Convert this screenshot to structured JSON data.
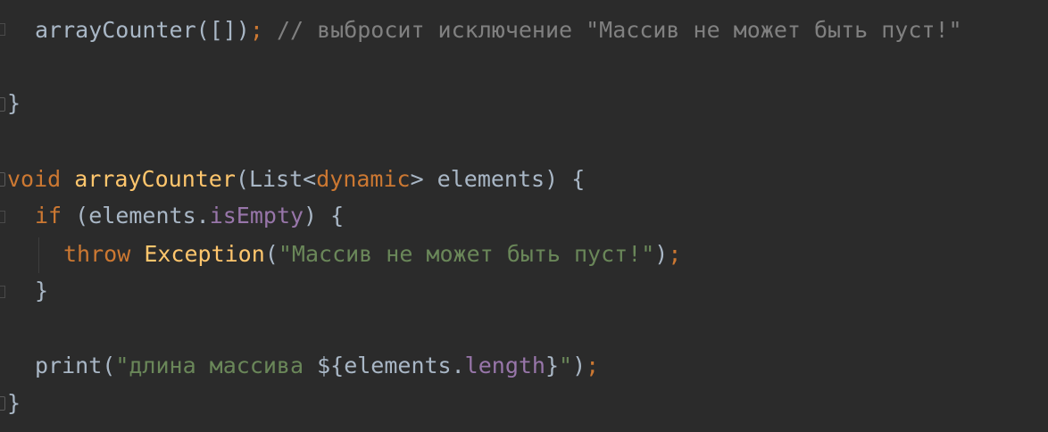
{
  "editor": {
    "lines": {
      "l1": {
        "call": "arrayCounter([])",
        "semi": ";",
        "comment": " // выбросит исключение \"Массив не может быть пуст!\""
      },
      "l2": {
        "brace": "}"
      },
      "l3": {
        "kw_void": "void",
        "fn_name": "arrayCounter",
        "open": "(List<",
        "type_dynamic": "dynamic",
        "rest": "> elements) {"
      },
      "l4": {
        "kw_if": "if",
        "open": " (elements.",
        "prop": "isEmpty",
        "close": ") {"
      },
      "l5": {
        "kw_throw": "throw",
        "space": " ",
        "cls": "Exception",
        "open": "(",
        "str": "\"Массив не может быть пуст!\"",
        "close": ")",
        "semi": ";"
      },
      "l6": {
        "brace": "}"
      },
      "l7": {
        "fn": "print(",
        "str_start": "\"длина массива ",
        "interp_open": "${elements.",
        "prop": "length",
        "interp_close": "}",
        "str_end": "\"",
        "close": ")",
        "semi": ";"
      },
      "l8": {
        "brace": "}"
      }
    },
    "colors": {
      "background": "#2b2b2b",
      "identifier": "#a9b7c6",
      "keyword": "#cc7832",
      "function": "#ffc66d",
      "string": "#6a8759",
      "comment": "#808080",
      "property": "#9876aa"
    }
  }
}
